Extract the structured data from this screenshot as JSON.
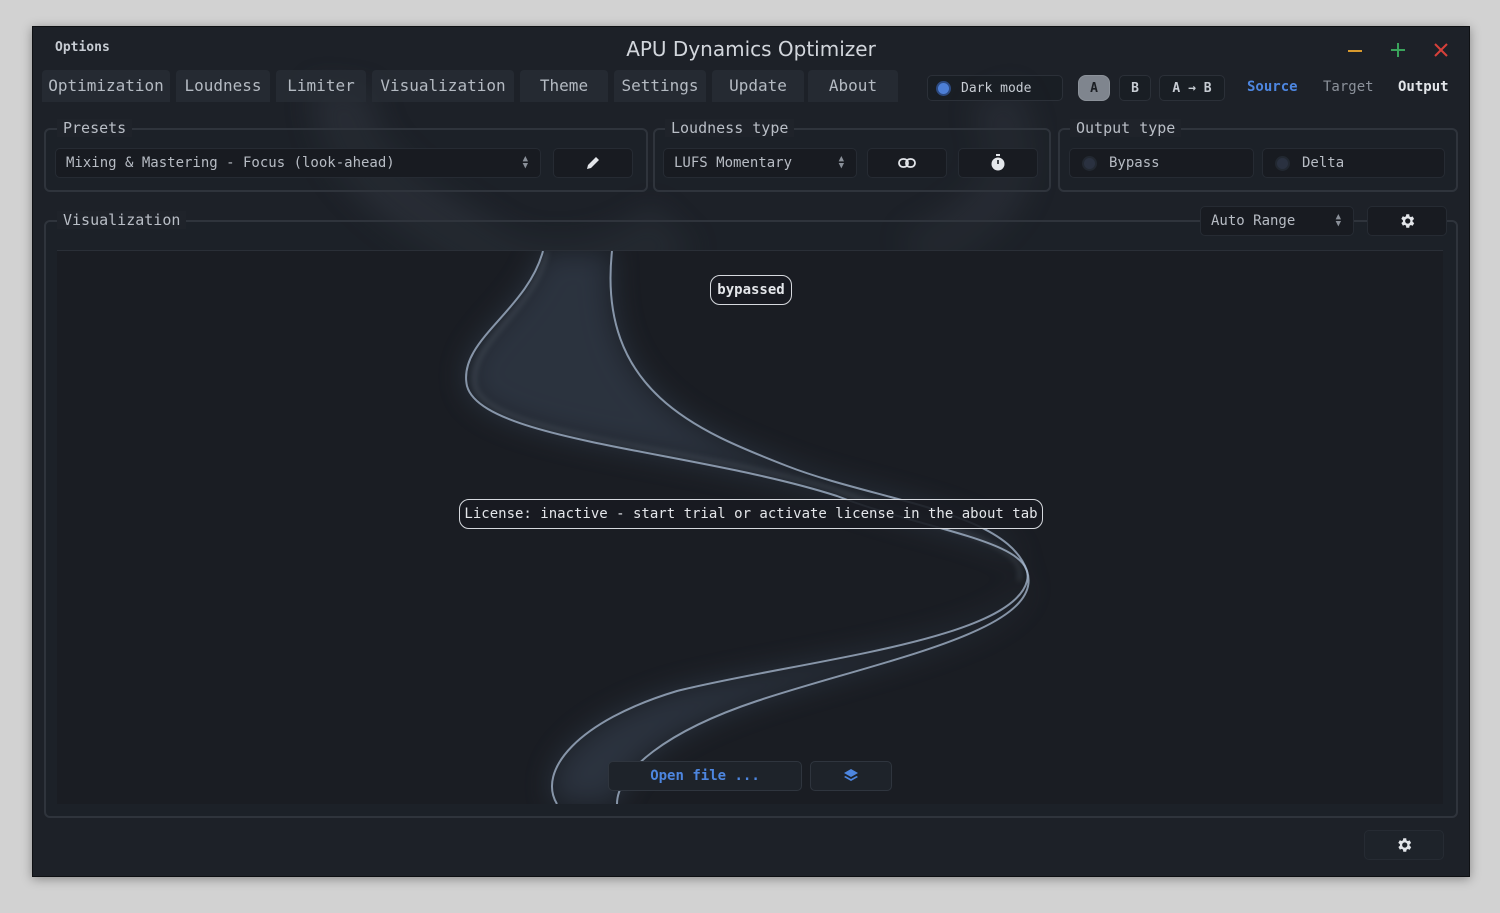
{
  "window": {
    "options_label": "Options",
    "title": "APU Dynamics Optimizer",
    "controls": {
      "minimize_color": "#d89a2e",
      "maximize_color": "#3aa35b",
      "close_color": "#d6403a"
    }
  },
  "tabs": [
    {
      "label": "Optimization"
    },
    {
      "label": "Loudness"
    },
    {
      "label": "Limiter"
    },
    {
      "label": "Visualization"
    },
    {
      "label": "Theme"
    },
    {
      "label": "Settings"
    },
    {
      "label": "Update"
    },
    {
      "label": "About"
    }
  ],
  "header": {
    "dark_mode_label": "Dark mode",
    "dark_mode_on": true,
    "ab": {
      "a_label": "A",
      "b_label": "B",
      "a_to_b_label": "A → B",
      "active": "A"
    },
    "signal": {
      "source_label": "Source",
      "target_label": "Target",
      "output_label": "Output",
      "source_color": "#4d86e0"
    }
  },
  "presets": {
    "group_label": "Presets",
    "selected": "Mixing & Mastering - Focus (look-ahead)",
    "edit_icon": "pencil-icon"
  },
  "loudness_type": {
    "group_label": "Loudness type",
    "selected": "LUFS Momentary",
    "link_icon": "link-icon",
    "timer_icon": "stopwatch-icon"
  },
  "output_type": {
    "group_label": "Output type",
    "options": [
      {
        "label": "Bypass",
        "selected": false
      },
      {
        "label": "Delta",
        "selected": false
      }
    ]
  },
  "visualization": {
    "group_label": "Visualization",
    "range_selected": "Auto Range",
    "settings_icon": "gear-icon",
    "status_badge": "bypassed",
    "license_message": "License: inactive - start trial or activate license in the about tab",
    "open_file_label": "Open file ...",
    "layers_icon": "layers-icon",
    "accent_color": "#4d86e0"
  },
  "footer": {
    "settings_icon": "gear-icon"
  }
}
